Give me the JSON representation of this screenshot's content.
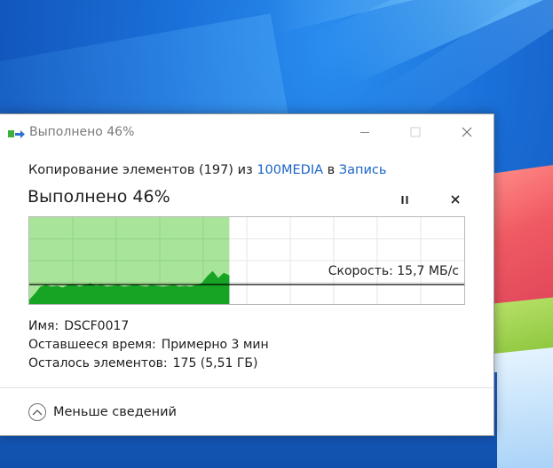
{
  "window": {
    "title": "Выполнено 46%",
    "icon": "copy-files-icon"
  },
  "copy": {
    "prefix": "Копирование элементов (197) из ",
    "source": "100MEDIA",
    "middle": " в ",
    "destination": "Запись",
    "status_title": "Выполнено 46%",
    "progress_fraction": 0.46,
    "speed_label": "Скорость: 15,7 МБ/с"
  },
  "details": {
    "name_key": "Имя:",
    "name_value": "DSCF0017",
    "time_key": "Оставшееся время:",
    "time_value": "Примерно 3 мин",
    "items_key": "Осталось элементов:",
    "items_value": "175 (5,51 ГБ)"
  },
  "footer": {
    "toggle_label": "Меньше сведений"
  },
  "colors": {
    "progress_fill": "#a8e49a",
    "speed_area": "#17a324",
    "link": "#1a64c8"
  },
  "speed_history": [
    0.05,
    0.12,
    0.2,
    0.22,
    0.2,
    0.21,
    0.19,
    0.22,
    0.23,
    0.2,
    0.22,
    0.24,
    0.21,
    0.22,
    0.2,
    0.21,
    0.22,
    0.2,
    0.21,
    0.23,
    0.21,
    0.2,
    0.22,
    0.21,
    0.2,
    0.21,
    0.22,
    0.2,
    0.21,
    0.2,
    0.22,
    0.24,
    0.32,
    0.38,
    0.3,
    0.36,
    0.33
  ]
}
